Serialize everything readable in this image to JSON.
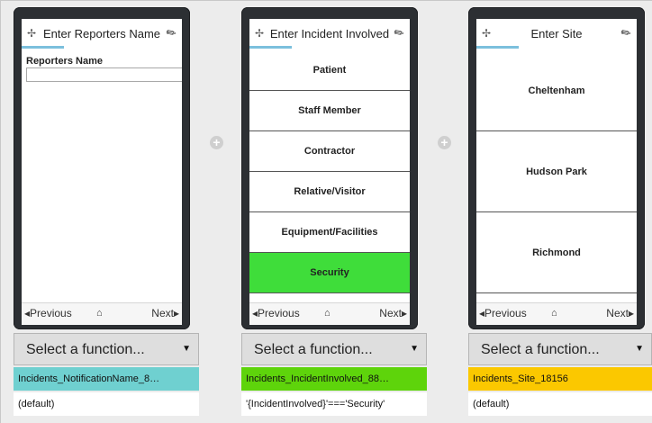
{
  "colors": {
    "teal_band": "#6fd0d0",
    "green_band": "#5ed40b",
    "yellow_band": "#fbc800",
    "selected_option": "#3fdd3a",
    "header_underline": "#7cc0dd"
  },
  "icons": {
    "pin": "pin-icon",
    "plug": "plug-icon",
    "home": "home-icon",
    "add": "plus-circle-icon",
    "caret": "caret-down-icon"
  },
  "nav": {
    "previous": "◂Previous",
    "next": "Next▸",
    "home_glyph": "⌂"
  },
  "screens": [
    {
      "title": "Enter Reporters Name",
      "field_label": "Reporters Name",
      "field_value": ""
    },
    {
      "title": "Enter Incident Involved",
      "options": [
        "Patient",
        "Staff Member",
        "Contractor",
        "Relative/Visitor",
        "Equipment/Facilities",
        "Security"
      ],
      "selected": "Security"
    },
    {
      "title": "Enter Site",
      "options": [
        "Cheltenham",
        "Hudson Park",
        "Richmond"
      ]
    }
  ],
  "functions": [
    {
      "select_label": "Select a function...",
      "name": "Incidents_NotificationName_8…",
      "condition": "(default)"
    },
    {
      "select_label": "Select a function...",
      "name": "Incidents_IncidentInvolved_88…",
      "condition": "'{IncidentInvolved}'==='Security'"
    },
    {
      "select_label": "Select a function...",
      "name": "Incidents_Site_18156",
      "condition": "(default)"
    }
  ]
}
